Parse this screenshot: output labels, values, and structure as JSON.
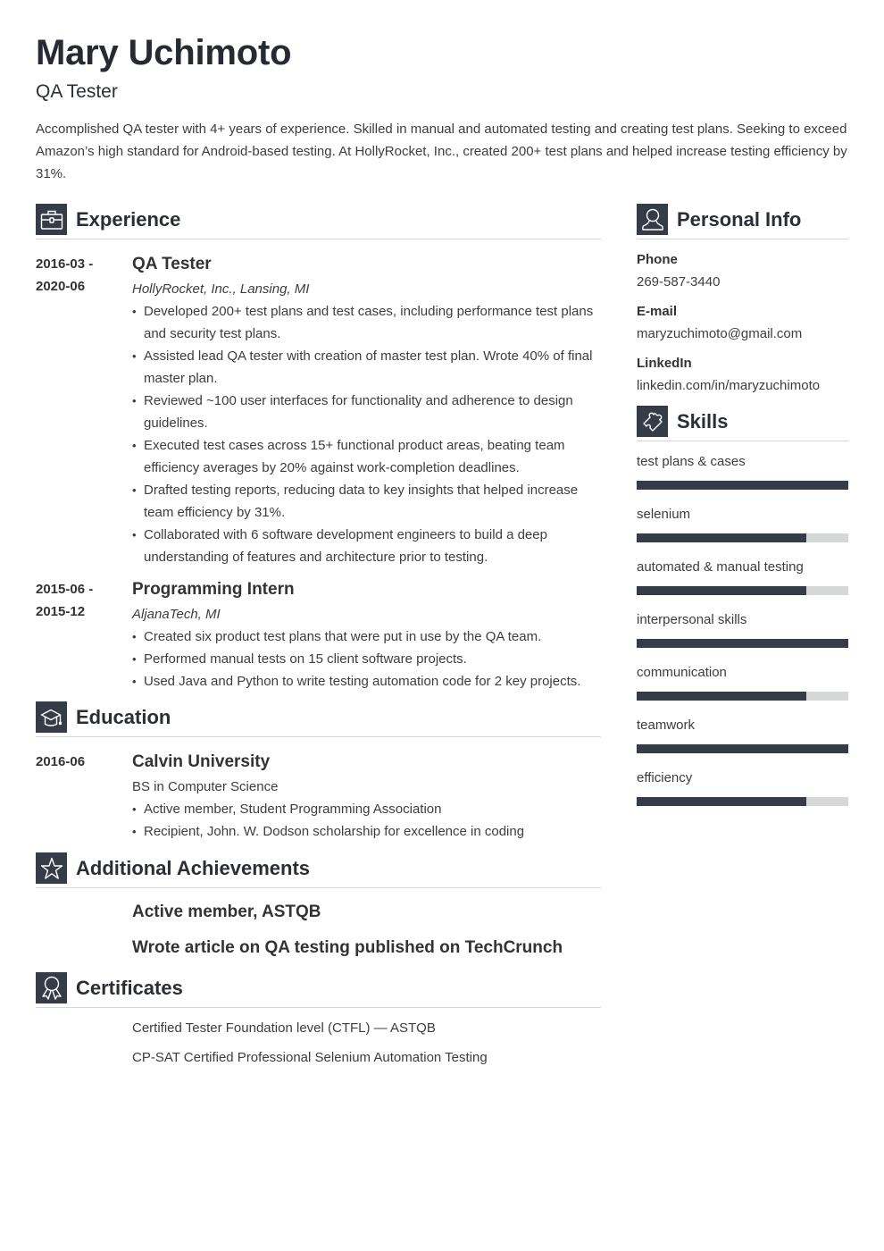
{
  "header": {
    "name": "Mary Uchimoto",
    "title": "QA Tester",
    "summary": "Accomplished QA tester with 4+ years of experience. Skilled in manual and automated testing and creating test plans. Seeking to exceed Amazon’s high standard for Android-based testing. At HollyRocket, Inc., created 200+ test plans and helped increase testing efficiency by 31%."
  },
  "colors": {
    "accent": "#353b47",
    "bar_track": "#d6d7d8",
    "divider": "#d6d6d6",
    "text": "#3d3d3d"
  },
  "experience": {
    "title": "Experience",
    "icon": "briefcase-icon",
    "items": [
      {
        "date_start": "2016-03 -",
        "date_end": "2020-06",
        "role": "QA Tester",
        "org": "HollyRocket, Inc., Lansing, MI",
        "bullets": [
          "Developed 200+ test plans and test cases, including performance test plans and security test plans.",
          "Assisted lead QA tester with creation of master test plan. Wrote 40% of final master plan.",
          "Reviewed ~100 user interfaces for functionality and adherence to design guidelines.",
          "Executed test cases across 15+ functional product areas, beating team efficiency averages by 20% against work-completion deadlines.",
          "Drafted testing reports, reducing data to key insights that helped increase team efficiency by 31%.",
          "Collaborated with 6 software development engineers to build a deep understanding of features and architecture prior to testing."
        ]
      },
      {
        "date_start": "2015-06 -",
        "date_end": "2015-12",
        "role": "Programming Intern",
        "org": "AljanaTech, MI",
        "bullets": [
          "Created six product test plans that were put in use by the QA team.",
          "Performed manual tests on 15 client software projects.",
          "Used Java and Python to write testing automation code for 2 key projects."
        ]
      }
    ]
  },
  "education": {
    "title": "Education",
    "icon": "graduation-cap-icon",
    "items": [
      {
        "date": "2016-06",
        "school": "Calvin University",
        "degree": "BS in Computer Science",
        "bullets": [
          "Active member, Student Programming Association",
          "Recipient, John. W. Dodson scholarship for excellence in coding"
        ]
      }
    ]
  },
  "achievements": {
    "title": "Additional Achievements",
    "icon": "star-icon",
    "items": [
      "Active member, ASTQB",
      "Wrote article on QA testing published on TechCrunch"
    ]
  },
  "certificates": {
    "title": "Certificates",
    "icon": "award-ribbon-icon",
    "items": [
      "Certified Tester Foundation level (CTFL) — ASTQB",
      "CP-SAT Certified Professional Selenium Automation Testing"
    ]
  },
  "personal_info": {
    "title": "Personal Info",
    "icon": "user-icon",
    "fields": [
      {
        "label": "Phone",
        "value": "269-587-3440"
      },
      {
        "label": "E-mail",
        "value": "maryzuchimoto@gmail.com"
      },
      {
        "label": "LinkedIn",
        "value": "linkedin.com/in/maryzuchimoto"
      }
    ]
  },
  "skills": {
    "title": "Skills",
    "icon": "puzzle-piece-icon",
    "items": [
      {
        "name": "test plans & cases",
        "level": 1.0
      },
      {
        "name": "selenium",
        "level": 0.8
      },
      {
        "name": "automated & manual testing",
        "level": 0.8
      },
      {
        "name": "interpersonal skills",
        "level": 1.0
      },
      {
        "name": "communication",
        "level": 0.8
      },
      {
        "name": "teamwork",
        "level": 1.0
      },
      {
        "name": "efficiency",
        "level": 0.8
      }
    ]
  }
}
